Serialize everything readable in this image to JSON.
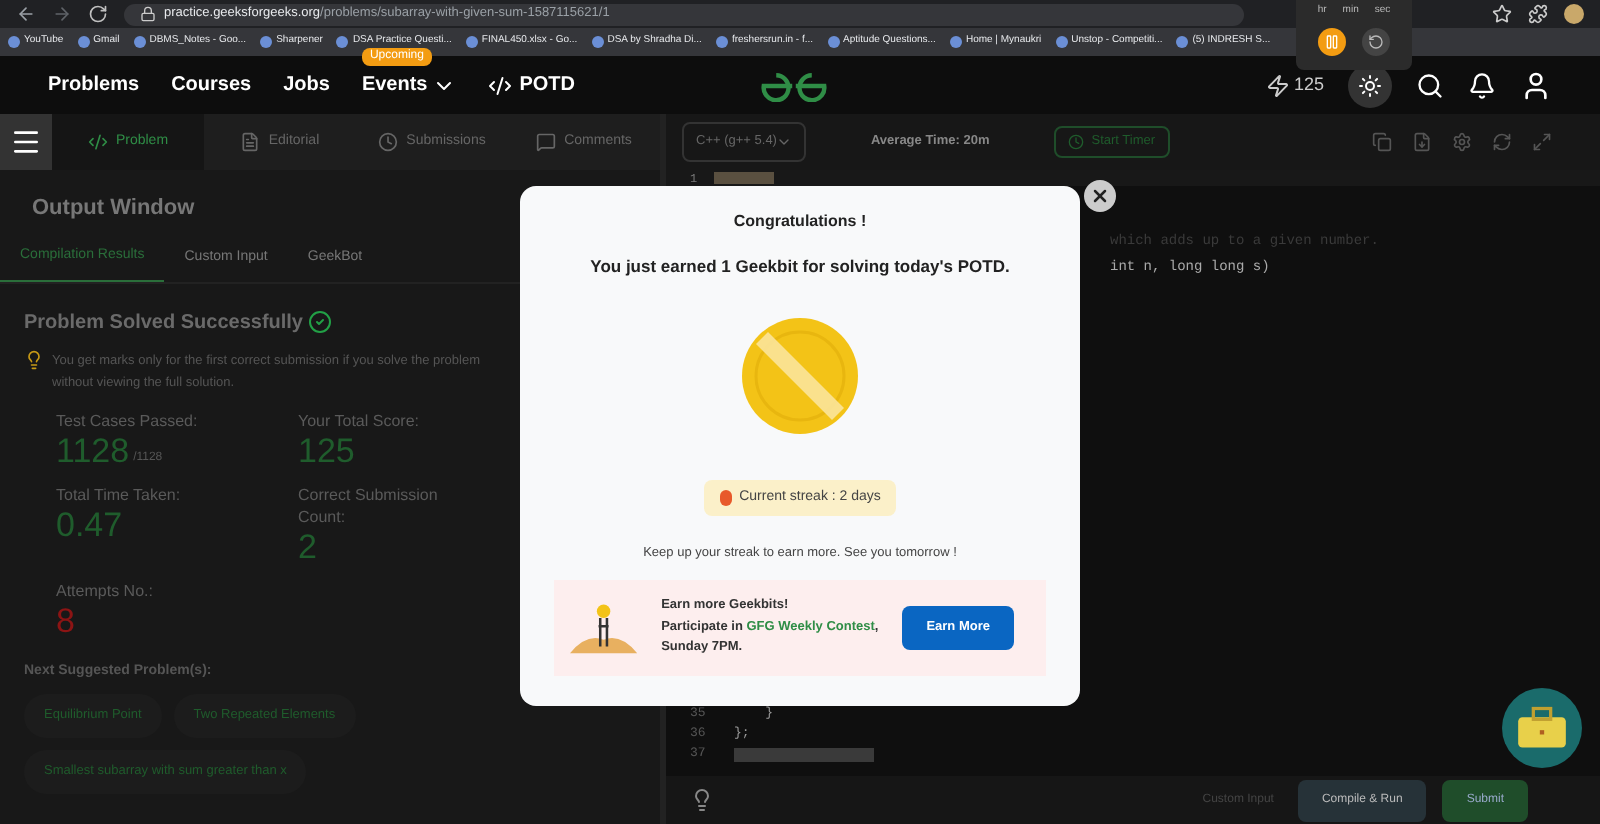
{
  "browser": {
    "url_host": "practice.geeksforgeeks.org",
    "url_path": "/problems/subarray-with-given-sum-1587115621/1",
    "bookmarks": [
      "YouTube",
      "Gmail",
      "DBMS_Notes - Goo...",
      "Sharpener",
      "DSA Practice Questi...",
      "FINAL450.xlsx - Go...",
      "DSA by Shradha Di...",
      "freshersrun.in - f...",
      "Aptitude Questions...",
      "Home | Mynaukri",
      "Unstop - Competiti...",
      "(5) INDRESH S..."
    ]
  },
  "timer": {
    "units": [
      "hr",
      "min",
      "sec"
    ]
  },
  "nav": {
    "links": [
      {
        "label": "Problems",
        "kind": "plain"
      },
      {
        "label": "Courses",
        "kind": "plain"
      },
      {
        "label": "Jobs",
        "kind": "plain"
      },
      {
        "label": "Events",
        "kind": "dropdown",
        "badge": "Upcoming"
      },
      {
        "label": "POTD",
        "kind": "code"
      }
    ],
    "geekbits": "125"
  },
  "problem_tabs": [
    {
      "label": "Problem",
      "selected": true
    },
    {
      "label": "Editorial",
      "selected": false
    },
    {
      "label": "Submissions",
      "selected": false
    },
    {
      "label": "Comments",
      "selected": false
    }
  ],
  "output": {
    "title": "Output Window",
    "tabs": [
      {
        "label": "Compilation Results",
        "selected": true
      },
      {
        "label": "Custom Input",
        "selected": false
      },
      {
        "label": "GeekBot",
        "selected": false
      }
    ],
    "heading": "Problem Solved Successfully",
    "hint": "You get marks only for the first correct submission if you solve the problem without viewing the full solution.",
    "stats": [
      {
        "label": "Test Cases Passed:",
        "value": "1128",
        "suffix": "/1128",
        "kind": "good"
      },
      {
        "label": "Your Total Score:",
        "value": "125",
        "kind": "good"
      },
      {
        "label": "Total Time Taken:",
        "value": "0.47",
        "kind": "good"
      },
      {
        "label": "Correct Submission Count:",
        "value": "2",
        "kind": "good"
      },
      {
        "label": "Attempts No.:",
        "value": "8",
        "kind": "bad"
      }
    ],
    "next_title": "Next Suggested Problem(s):",
    "suggestions": [
      "Equilibrium Point",
      "Two Repeated Elements",
      "Smallest subarray with sum greater than x"
    ]
  },
  "editor": {
    "language": "C++ (g++ 5.4)",
    "average_time": "Average Time: 20m",
    "start_timer": "Start Timer",
    "top_lines": [
      {
        "number": "1"
      }
    ],
    "fragments": [
      "which adds up to a given number.",
      "int n, long long s)"
    ],
    "bottom_lines": [
      {
        "number": "35",
        "code": "    }"
      },
      {
        "number": "36",
        "code": "};"
      },
      {
        "number": "37"
      }
    ],
    "custom_input": "Custom Input",
    "compile": "Compile & Run",
    "submit": "Submit"
  },
  "modal": {
    "title": "Congratulations !",
    "message": "You just earned 1 Geekbit for solving today's POTD.",
    "streak": "Current streak : 2 days",
    "keep": "Keep up your streak to earn more. See you tomorrow !",
    "promo": {
      "heading": "Earn more Geekbits!",
      "line_start": "Participate in ",
      "link": "GFG Weekly Contest",
      "line_end": ",",
      "last": "Sunday 7PM.",
      "button": "Earn More"
    }
  }
}
